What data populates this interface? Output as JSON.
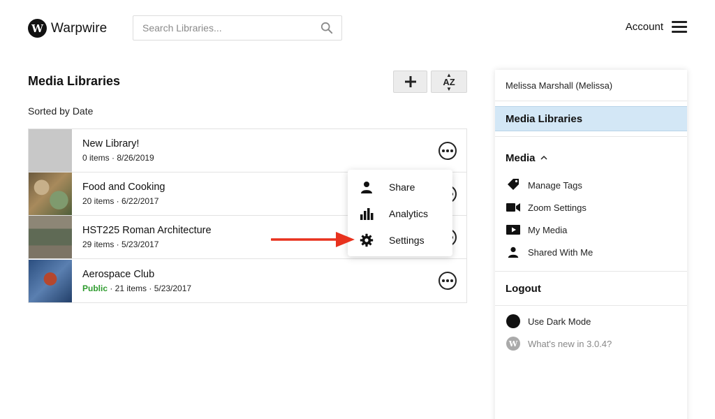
{
  "header": {
    "logo_letter": "W",
    "logo_text": "Warpwire",
    "search_placeholder": "Search Libraries...",
    "account_label": "Account"
  },
  "main": {
    "title": "Media Libraries",
    "sort_label": "Sorted by Date",
    "sort_button": {
      "top": "A",
      "bottom": "Z"
    },
    "libraries": [
      {
        "name": "New Library!",
        "meta": "0 items · 8/26/2019",
        "public": ""
      },
      {
        "name": "Food and Cooking",
        "meta": "20 items · 6/22/2017",
        "public": ""
      },
      {
        "name": "HST225 Roman Architecture",
        "meta": "29 items · 5/23/2017",
        "public": ""
      },
      {
        "name": "Aerospace Club",
        "meta": " · 21 items · 5/23/2017",
        "public": "Public"
      }
    ]
  },
  "popup_menu": {
    "items": [
      {
        "label": "Share",
        "icon": "person-icon"
      },
      {
        "label": "Analytics",
        "icon": "bar-chart-icon"
      },
      {
        "label": "Settings",
        "icon": "gear-icon"
      }
    ]
  },
  "sidebar": {
    "user": "Melissa Marshall (Melissa)",
    "active": "Media Libraries",
    "media_section": "Media",
    "media_items": [
      {
        "label": "Manage Tags",
        "icon": "tag-icon"
      },
      {
        "label": "Zoom Settings",
        "icon": "video-camera-icon"
      },
      {
        "label": "My Media",
        "icon": "play-icon"
      },
      {
        "label": "Shared With Me",
        "icon": "person-icon"
      }
    ],
    "logout": "Logout",
    "dark_mode": "Use Dark Mode",
    "whats_new": "What's new in 3.0.4?"
  },
  "colors": {
    "accent_blue_bg": "#d3e7f6",
    "public_green": "#2e9b2e",
    "arrow_red": "#e8321e"
  }
}
